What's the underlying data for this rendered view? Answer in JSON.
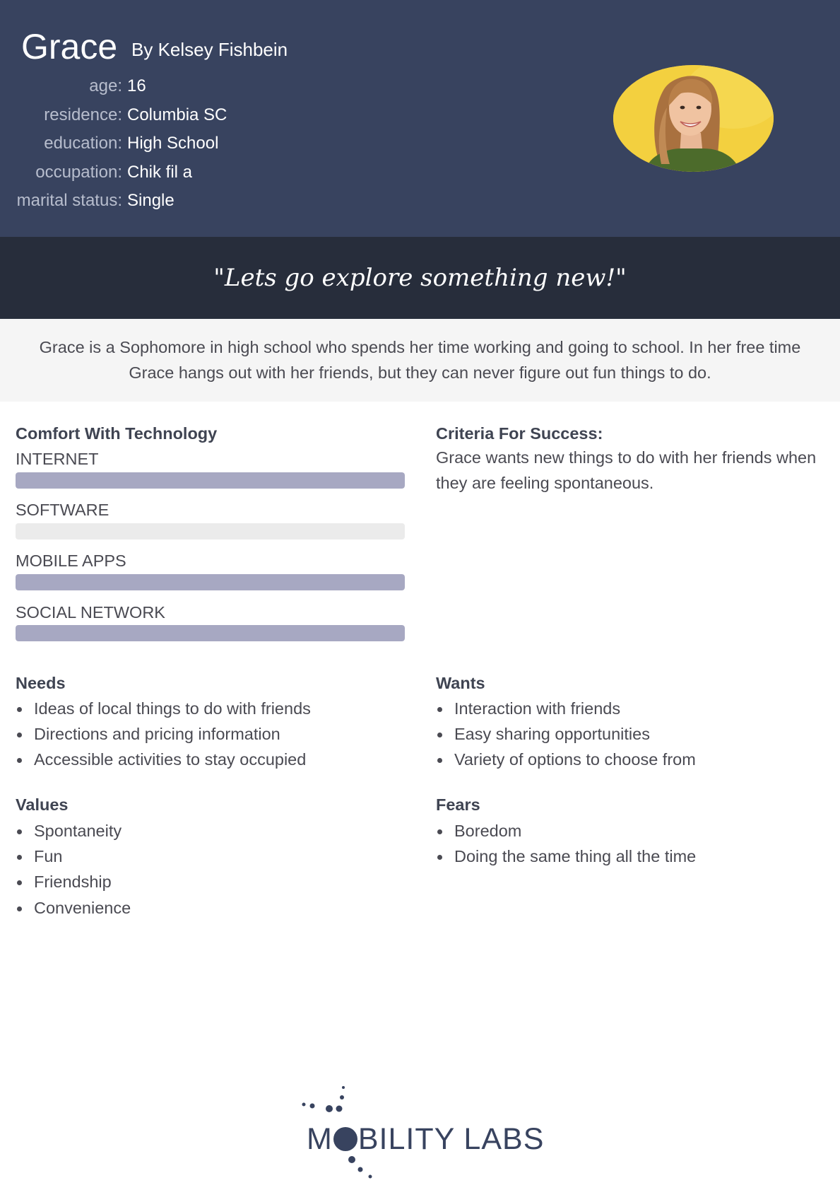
{
  "persona": {
    "name": "Grace",
    "author": "By Kelsey Fishbein",
    "facts": [
      {
        "label": "age:",
        "value": "16"
      },
      {
        "label": "residence:",
        "value": "Columbia SC"
      },
      {
        "label": "education:",
        "value": "High School"
      },
      {
        "label": "occupation:",
        "value": "Chik fil a"
      },
      {
        "label": "marital status:",
        "value": "Single"
      }
    ],
    "photo": "portrait photo of smiling girl on yellow background"
  },
  "quote": "\"Lets go explore something new!\"",
  "bio": "Grace is a Sophomore in high school who spends her time working and going to school. In her free time Grace hangs out with her friends, but they can never figure out fun things to do.",
  "tech": {
    "title": "Comfort With Technology",
    "items": [
      {
        "label": "INTERNET",
        "level": 1.0
      },
      {
        "label": "SOFTWARE",
        "level": 0.0
      },
      {
        "label": "MOBILE APPS",
        "level": 1.0
      },
      {
        "label": "SOCIAL NETWORK",
        "level": 1.0
      }
    ]
  },
  "criteria": {
    "title": "Criteria For Success:",
    "text": "Grace wants new things to do with her friends when they are feeling spontaneous."
  },
  "needs": {
    "title": "Needs",
    "items": [
      "Ideas of local things to do with friends",
      "Directions and pricing information",
      "Accessible activities to stay occupied"
    ]
  },
  "wants": {
    "title": "Wants",
    "items": [
      "Interaction with friends",
      "Easy sharing opportunities",
      "Variety of options to choose from"
    ]
  },
  "values": {
    "title": "Values",
    "items": [
      "Spontaneity",
      "Fun",
      "Friendship",
      "Convenience"
    ]
  },
  "fears": {
    "title": "Fears",
    "items": [
      "Boredom",
      "Doing the same thing all the time"
    ]
  },
  "logo": {
    "text": "MOBILITY LABS",
    "text_before": "M",
    "text_after": "BILITY LABS"
  },
  "colors": {
    "header_bg": "#38435f",
    "quote_bg": "#272d3b",
    "bar_fill": "#a7a8c2",
    "bar_track": "#ebebeb"
  }
}
